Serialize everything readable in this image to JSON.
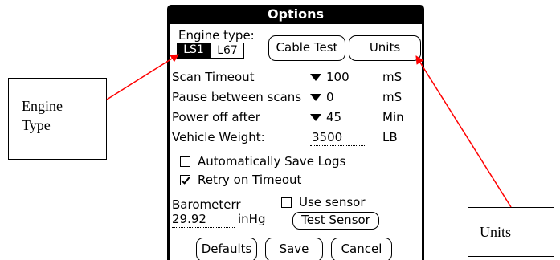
{
  "dialog": {
    "title": "Options",
    "engine_type_label": "Engine type:",
    "engine_options": [
      "LS1",
      "L67"
    ],
    "engine_selected": "LS1",
    "cable_test_label": "Cable Test",
    "units_label": "Units",
    "rows": [
      {
        "label": "Scan Timeout",
        "value": "100",
        "unit": "mS"
      },
      {
        "label": "Pause between scans",
        "value": "0",
        "unit": "mS"
      },
      {
        "label": "Power off after",
        "value": "45",
        "unit": "Min"
      }
    ],
    "vehicle_weight": {
      "label": "Vehicle Weight:",
      "value": "3500",
      "unit": "LB"
    },
    "auto_save": {
      "label": "Automatically Save Logs",
      "checked": false
    },
    "retry": {
      "label": "Retry on Timeout",
      "checked": true
    },
    "barometer": {
      "label": "Barometerr",
      "use_sensor_label": "Use sensor",
      "use_sensor_checked": false,
      "value": "29.92",
      "unit": "inHg",
      "test_sensor_label": "Test Sensor"
    },
    "buttons": {
      "defaults": "Defaults",
      "save": "Save",
      "cancel": "Cancel"
    }
  },
  "callouts": {
    "engine_line1": "Engine",
    "engine_line2": "Type",
    "units": "Units"
  },
  "colors": {
    "arrow": "#ff0000",
    "titlebar": "#000000"
  }
}
